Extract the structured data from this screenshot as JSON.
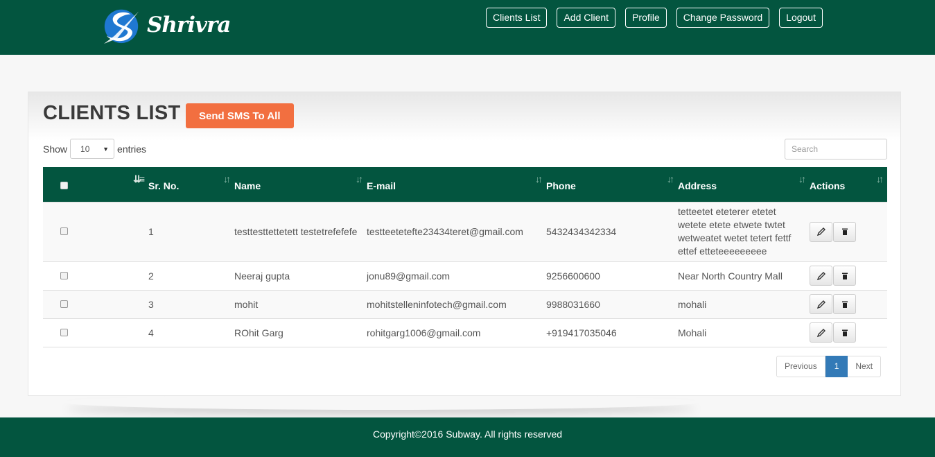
{
  "brand": {
    "name": "Shrivra"
  },
  "nav": [
    "Clients List",
    "Add Client",
    "Profile",
    "Change Password",
    "Logout"
  ],
  "page": {
    "title": "CLIENTS LIST",
    "sms_button": "Send SMS To All"
  },
  "controls": {
    "show_label": "Show",
    "entries_value": "10",
    "entries_label": "entries",
    "search_placeholder": "Search"
  },
  "table": {
    "columns": [
      "Sr. No.",
      "Name",
      "E-mail",
      "Phone",
      "Address",
      "Actions"
    ],
    "rows": [
      {
        "sr": "1",
        "name": "testtesttettetett testetrefefefe",
        "email": "testteetetefte23434teret@gmail.com",
        "phone": "5432434342334",
        "address": "tetteetet eteterer etetet wetete etete etwete twtet wetweatet wetet tetert fettf ettef etteteeeeeeeee"
      },
      {
        "sr": "2",
        "name": "Neeraj gupta",
        "email": "jonu89@gmail.com",
        "phone": "9256600600",
        "address": "Near North Country Mall"
      },
      {
        "sr": "3",
        "name": "mohit",
        "email": "mohitstelleninfotech@gmail.com",
        "phone": "9988031660",
        "address": "mohali"
      },
      {
        "sr": "4",
        "name": "ROhit Garg",
        "email": "rohitgarg1006@gmail.com",
        "phone": "+919417035046",
        "address": "Mohali"
      }
    ]
  },
  "pagination": {
    "previous": "Previous",
    "current": "1",
    "next": "Next"
  },
  "footer": {
    "text": "Copyright©2016 Subway. All rights reserved"
  },
  "colors": {
    "primary": "#03553f",
    "accent": "#f26f40",
    "page_active": "#337ab7"
  },
  "icons": {
    "edit": "pencil-icon",
    "delete": "trash-icon",
    "sort": "sort-icon"
  }
}
